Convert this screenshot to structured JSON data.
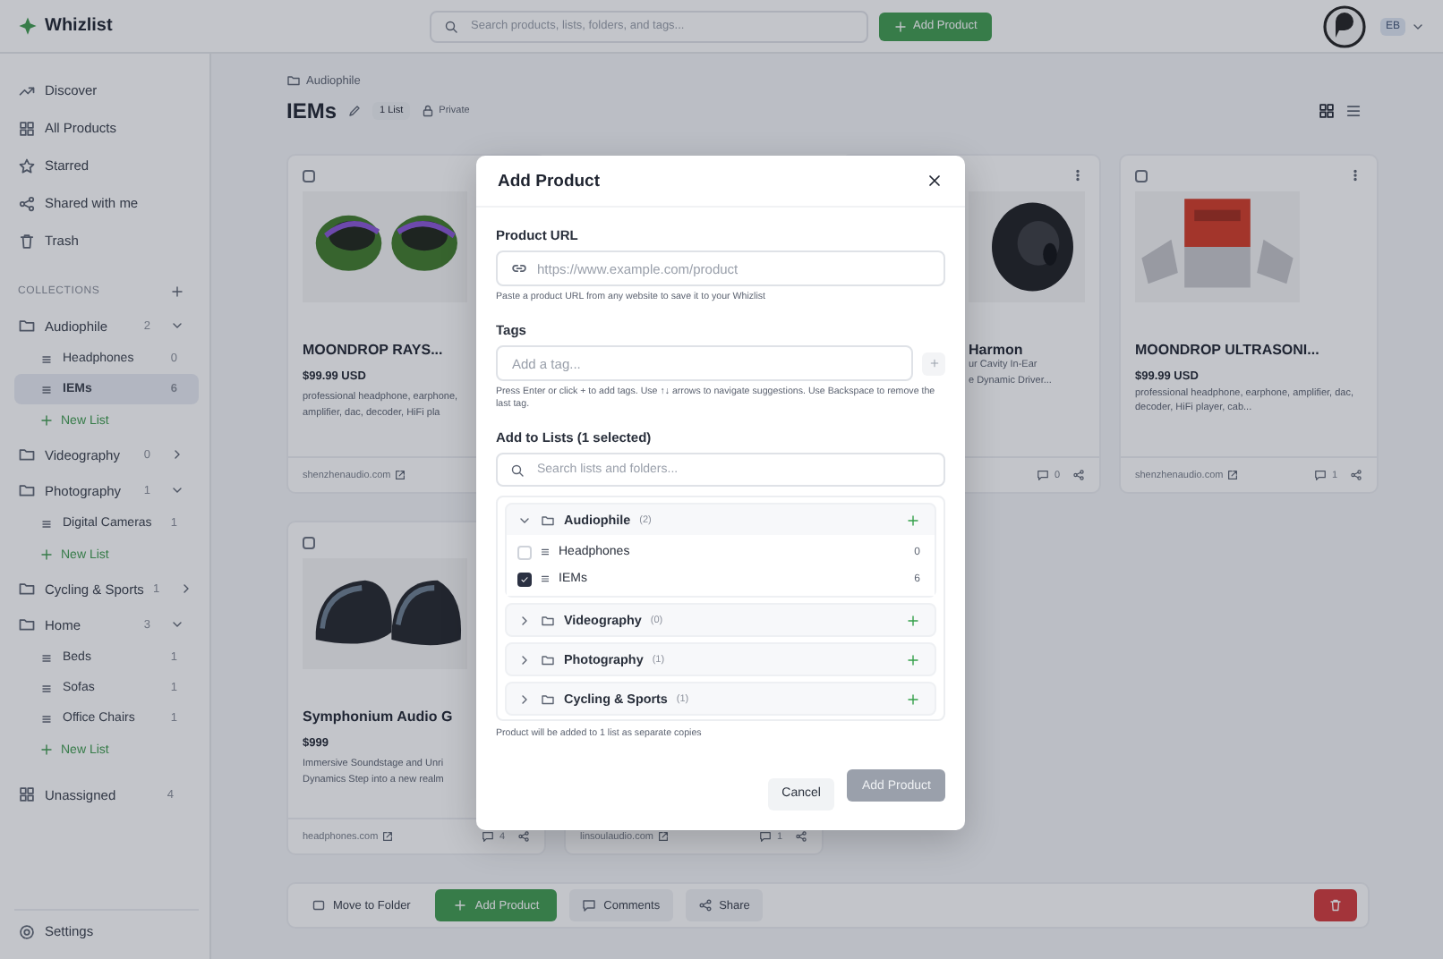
{
  "topbar": {
    "logo": "Whizlist",
    "search_placeholder": "Search products, lists, folders, and tags...",
    "add_button": "Add Product",
    "account": "EB"
  },
  "sidebar": {
    "nav": [
      {
        "label": "Discover"
      },
      {
        "label": "All Products"
      },
      {
        "label": "Starred"
      },
      {
        "label": "Shared with me"
      },
      {
        "label": "Trash"
      }
    ],
    "section": "COLLECTIONS",
    "collections": [
      {
        "name": "Audiophile",
        "count": "2",
        "expanded": true,
        "children": [
          {
            "name": "Headphones",
            "count": "0",
            "selected": false
          },
          {
            "name": "IEMs",
            "count": "6",
            "selected": true
          }
        ],
        "new_list": "New List"
      },
      {
        "name": "Videography",
        "count": "0",
        "expanded": false
      },
      {
        "name": "Photography",
        "count": "1",
        "expanded": true,
        "children": [
          {
            "name": "Digital Cameras",
            "count": "1",
            "selected": false
          }
        ],
        "new_list": "New List"
      },
      {
        "name": "Cycling & Sports",
        "count": "1",
        "expanded": false
      },
      {
        "name": "Home",
        "count": "3",
        "expanded": true,
        "children": [
          {
            "name": "Beds",
            "count": "1",
            "selected": false
          },
          {
            "name": "Sofas",
            "count": "1",
            "selected": false
          },
          {
            "name": "Office Chairs",
            "count": "1",
            "selected": false
          }
        ],
        "new_list": "New List"
      }
    ],
    "unassigned": {
      "label": "Unassigned",
      "count": "4"
    },
    "settings": "Settings"
  },
  "header": {
    "breadcrumb": "Audiophile",
    "title": "IEMs",
    "badge": "1 List",
    "privacy": "Private"
  },
  "cards": [
    {
      "kind": "full",
      "checked": false,
      "title": "MOONDROP RAYS...",
      "price": "$99.99 USD",
      "description_lines": [
        "professional headphone, earphone,",
        "amplifier, dac, decoder, HiFi pla"
      ],
      "source": "shenzhenaudio.com"
    },
    {
      "kind": "right_part",
      "menu": true,
      "title": "Harmon",
      "description_lines": [
        "ur Cavity In-Ear",
        "e Dynamic Driver..."
      ],
      "comments": "0"
    },
    {
      "kind": "full",
      "checked": false,
      "menu": true,
      "title": "MOONDROP ULTRASONI...",
      "price": "$99.99 USD",
      "description": "professional headphone, earphone, amplifier, dac, decoder, HiFi player, cab...",
      "source": "shenzhenaudio.com",
      "comments": "1"
    },
    {
      "kind": "left_part",
      "checked": false,
      "title": "Symphonium Audio G",
      "price": "$999",
      "description_lines": [
        "Immersive Soundstage and Unri",
        "Dynamics Step into a new realm"
      ],
      "source": "headphones.com",
      "comments": "4"
    },
    {
      "kind": "footer_only",
      "source": "linsoulaudio.com",
      "comments": "1"
    }
  ],
  "bottom_bar": [
    {
      "kind": "plain",
      "label": "Move to Folder"
    },
    {
      "kind": "primary",
      "label": "Add Product"
    },
    {
      "kind": "soft",
      "label": "Comments"
    },
    {
      "kind": "soft",
      "label": "Share"
    },
    {
      "kind": "danger"
    }
  ],
  "modal": {
    "title": "Add Product",
    "url": {
      "label": "Product URL",
      "placeholder": "https://www.example.com/product",
      "hint": "Paste a product URL from any website to save it to your Whizlist"
    },
    "tags": {
      "label": "Tags",
      "placeholder": "Add a tag...",
      "hint": "Press Enter or click + to add tags. Use ↑↓ arrows to navigate suggestions. Use Backspace to remove the last tag."
    },
    "lists": {
      "label": "Add to Lists (1 selected)",
      "search_placeholder": "Search lists and folders...",
      "folders": [
        {
          "name": "Audiophile",
          "count": "(2)",
          "expanded": true,
          "lists": [
            {
              "name": "Headphones",
              "count": "0",
              "checked": false
            },
            {
              "name": "IEMs",
              "count": "6",
              "checked": true
            }
          ]
        },
        {
          "name": "Videography",
          "count": "(0)",
          "expanded": false
        },
        {
          "name": "Photography",
          "count": "(1)",
          "expanded": false
        },
        {
          "name": "Cycling & Sports",
          "count": "(1)",
          "expanded": false
        }
      ],
      "note": "Product will be added to 1 list as separate copies"
    },
    "buttons": [
      {
        "label": "Cancel",
        "kind": "secondary"
      },
      {
        "label": "Add Product",
        "kind": "primary",
        "disabled": true
      }
    ]
  }
}
